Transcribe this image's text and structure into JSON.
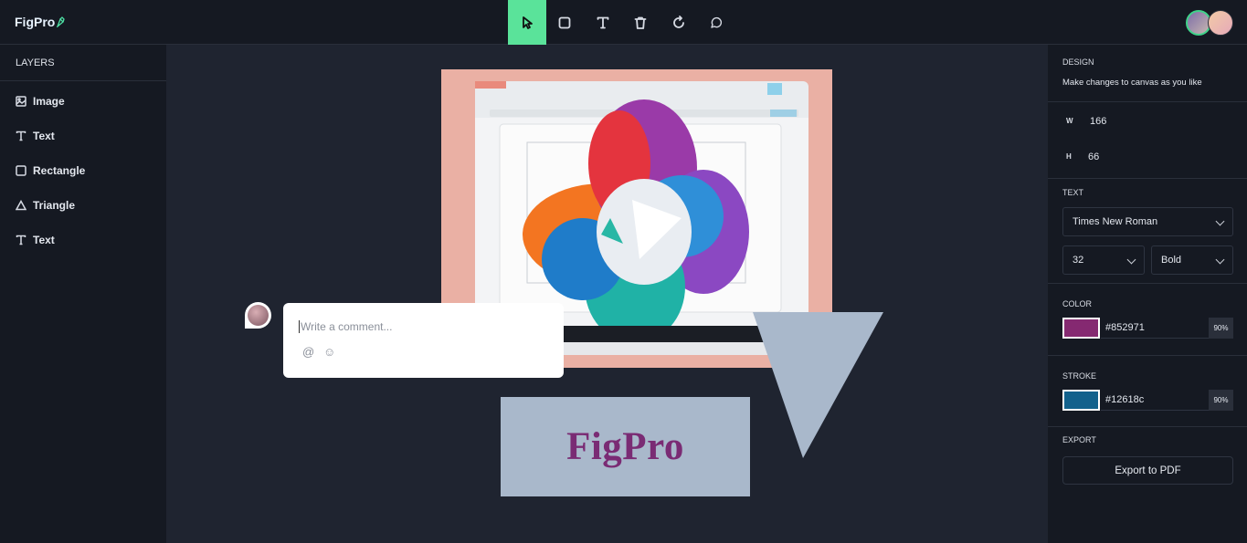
{
  "app": {
    "logo_main": "FigPro",
    "logo_icon": "pen-nib-icon"
  },
  "toolbar": {
    "tools": [
      {
        "name": "select",
        "icon": "cursor-icon",
        "active": true
      },
      {
        "name": "rectangle",
        "icon": "square-icon",
        "active": false
      },
      {
        "name": "text",
        "icon": "text-icon",
        "active": false
      },
      {
        "name": "delete",
        "icon": "trash-icon",
        "active": false
      },
      {
        "name": "reset",
        "icon": "rotate-icon",
        "active": false
      },
      {
        "name": "comment",
        "icon": "message-icon",
        "active": false
      }
    ],
    "active_color": "#5ae39a"
  },
  "layers": {
    "title": "LAYERS",
    "items": [
      {
        "label": "Image",
        "icon": "image-icon"
      },
      {
        "label": "Text",
        "icon": "text-icon"
      },
      {
        "label": "Rectangle",
        "icon": "square-icon"
      },
      {
        "label": "Triangle",
        "icon": "triangle-icon"
      },
      {
        "label": "Text",
        "icon": "text-icon"
      }
    ]
  },
  "canvas": {
    "text_object": "FigPro",
    "text_color": "#852971",
    "comment_placeholder": "Write a comment..."
  },
  "design": {
    "title": "DESIGN",
    "subtitle": "Make changes to canvas as you like",
    "width_label": "W",
    "width_value": "166",
    "height_label": "H",
    "height_value": "66",
    "text_section": "TEXT",
    "font_family": "Times New Roman",
    "font_size": "32",
    "font_weight": "Bold",
    "color_section": "COLOR",
    "fill_hex": "#852971",
    "fill_opacity": "90%",
    "stroke_section": "STROKE",
    "stroke_hex": "#12618c",
    "stroke_opacity": "90%",
    "export_section": "EXPORT",
    "export_button": "Export to PDF"
  }
}
